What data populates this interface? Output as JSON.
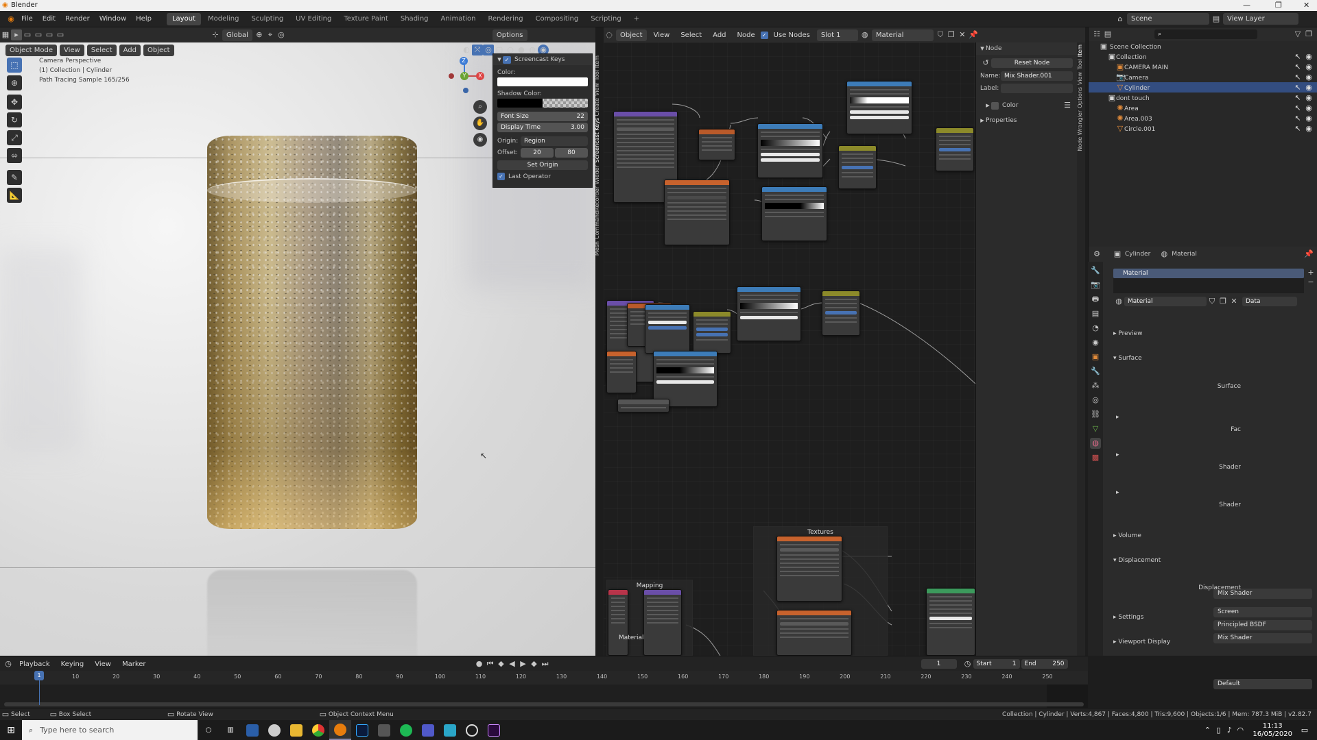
{
  "window": {
    "title": "Blender",
    "controls": [
      "—",
      "❐",
      "✕"
    ]
  },
  "menu": [
    "File",
    "Edit",
    "Render",
    "Window",
    "Help"
  ],
  "workspaces": [
    {
      "label": "Layout",
      "active": true
    },
    {
      "label": "Modeling"
    },
    {
      "label": "Sculpting"
    },
    {
      "label": "UV Editing"
    },
    {
      "label": "Texture Paint"
    },
    {
      "label": "Shading"
    },
    {
      "label": "Animation"
    },
    {
      "label": "Rendering"
    },
    {
      "label": "Compositing"
    },
    {
      "label": "Scripting"
    }
  ],
  "scene": {
    "label": "Scene",
    "view_layer": "View Layer"
  },
  "viewport": {
    "mode": "Object Mode",
    "menus": [
      "View",
      "Select",
      "Add",
      "Object"
    ],
    "orientation": "Global",
    "options": "Options",
    "overlay": [
      "Camera Perspective",
      "(1) Collection | Cylinder",
      "Path Tracing Sample 165/256"
    ]
  },
  "screencast_panel": {
    "title": "Screencast Keys",
    "color_label": "Color:",
    "shadow_label": "Shadow Color:",
    "font_size_label": "Font Size",
    "font_size": "22",
    "display_time_label": "Display Time",
    "display_time": "3.00",
    "origin_label": "Origin:",
    "origin": "Region",
    "offset_label": "Offset:",
    "offset_x": "20",
    "offset_y": "80",
    "set_origin": "Set Origin",
    "last_operator": "Last Operator"
  },
  "viewport_tabs": [
    "Item",
    "Tool",
    "View",
    "Create",
    "Screencast Keys",
    "Wieder",
    "CommandRecorder",
    "Mesh"
  ],
  "node_editor": {
    "type": "Object",
    "menus": [
      "View",
      "Select",
      "Add",
      "Node"
    ],
    "use_nodes": "Use Nodes",
    "slot": "Slot 1",
    "material": "Material",
    "frames": {
      "textures": "Textures",
      "mapping": "Mapping",
      "material": "Material"
    }
  },
  "node_panel": {
    "header": "Node",
    "reset": "Reset Node",
    "name_label": "Name:",
    "name": "Mix Shader.001",
    "label_label": "Label:",
    "color": "Color",
    "properties": "Properties"
  },
  "node_tabs": [
    "Item",
    "Tool",
    "View",
    "Options",
    "Node Wrangler"
  ],
  "outliner": {
    "root": "Scene Collection",
    "rows": [
      {
        "label": "Collection",
        "indent": 1,
        "icon": "collection"
      },
      {
        "label": "CAMERA MAIN",
        "indent": 2,
        "icon": "object"
      },
      {
        "label": "Camera",
        "indent": 2,
        "icon": "camera"
      },
      {
        "label": "Cylinder",
        "indent": 2,
        "icon": "mesh",
        "selected": true
      },
      {
        "label": "dont touch",
        "indent": 1,
        "icon": "collection"
      },
      {
        "label": "Area",
        "indent": 2,
        "icon": "light"
      },
      {
        "label": "Area.003",
        "indent": 2,
        "icon": "light"
      },
      {
        "label": "Circle.001",
        "indent": 2,
        "icon": "mesh"
      }
    ]
  },
  "properties": {
    "object": "Cylinder",
    "tab": "Material",
    "slot": "Material",
    "material": "Material",
    "data": "Data",
    "preview": "Preview",
    "surface_section": "Surface",
    "surface_label": "Surface",
    "surface": "Mix Shader",
    "fac_label": "Fac",
    "fac": "Screen",
    "shader1_label": "Shader",
    "shader1": "Principled BSDF",
    "shader2_label": "Shader",
    "shader2": "Mix Shader",
    "volume": "Volume",
    "displacement_section": "Displacement",
    "displacement_label": "Displacement",
    "displacement": "Default",
    "settings": "Settings",
    "viewport_display": "Viewport Display"
  },
  "timeline": {
    "menus": [
      "Playback",
      "Keying",
      "View",
      "Marker"
    ],
    "current": "1",
    "start_label": "Start",
    "start": "1",
    "end_label": "End",
    "end": "250",
    "ticks": [
      "1",
      "10",
      "20",
      "30",
      "40",
      "50",
      "60",
      "70",
      "80",
      "90",
      "100",
      "110",
      "120",
      "130",
      "140",
      "150",
      "160",
      "170",
      "180",
      "190",
      "200",
      "210",
      "220",
      "230",
      "240",
      "250"
    ]
  },
  "status": {
    "select": "Select",
    "box": "Box Select",
    "rotate": "Rotate View",
    "context": "Object Context Menu",
    "info": "Collection | Cylinder | Verts:4,867 | Faces:4,800 | Tris:9,600 | Objects:1/6 | Mem: 787.3 MiB | v2.82.7"
  },
  "taskbar": {
    "search": "Type here to search",
    "time": "11:13",
    "date": "16/05/2020"
  }
}
